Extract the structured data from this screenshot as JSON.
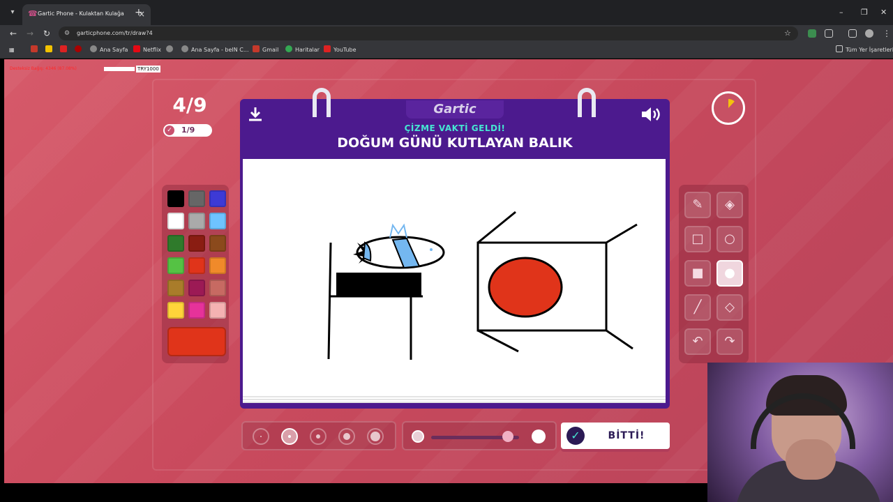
{
  "browser": {
    "tab_title": "Gartic Phone - Kulaktan Kulağa",
    "url": "garticphone.com/tr/draw?4",
    "bookmarks": [
      "Ana Sayfa",
      "Netflix",
      "Ana Sayfa - beIN C...",
      "Gmail",
      "Haritalar",
      "YouTube"
    ],
    "all_bookmarks": "Tüm Yer İşaretleri"
  },
  "overlay": {
    "debug_text": "Desteksiz Bağış:   4346 (87.08%)",
    "try_label": "TRY1000"
  },
  "game": {
    "round": "4/9",
    "progress": "1/9",
    "logo": "Gartic",
    "subtitle": "ÇİZME VAKTİ GELDİ!",
    "prompt": "DOĞUM GÜNÜ KUTLAYAN BALIK",
    "done_label": "BİTTİ!",
    "timer_elapsed_fraction": 0.12,
    "opacity_level_fraction": 0.87
  },
  "palette": {
    "colors": [
      "#000000",
      "#666666",
      "#3d3ad6",
      "#ffffff",
      "#aaaaaa",
      "#6ec3ff",
      "#2f7a2b",
      "#8a1d12",
      "#8b4a1c",
      "#55c244",
      "#e0341a",
      "#f08a2a",
      "#a97c2a",
      "#9c1a55",
      "#c76a62",
      "#ffd43a",
      "#e6329a",
      "#f4b2b2"
    ],
    "selected_color": "#e0341a"
  },
  "icons": {
    "download": "download-icon",
    "sound": "volume-icon",
    "pencil": "pencil-icon",
    "eraser": "eraser-icon",
    "rect": "rectangle-outline-icon",
    "ellipse": "ellipse-outline-icon",
    "rect_fill": "rectangle-fill-icon",
    "ellipse_fill": "ellipse-fill-icon",
    "line": "line-icon",
    "bucket": "fill-bucket-icon",
    "undo": "undo-icon",
    "redo": "redo-icon"
  }
}
